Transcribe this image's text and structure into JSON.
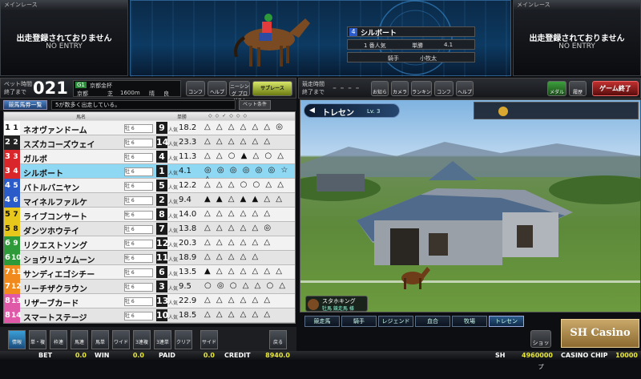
{
  "left_panel": {
    "header": "メインレース",
    "msg_jp": "出走登録されておりません",
    "msg_en": "NO ENTRY"
  },
  "right_panel": {
    "header": "メインレース",
    "msg_jp": "出走登録されておりません",
    "msg_en": "NO ENTRY"
  },
  "center_info": {
    "num": "4",
    "name": "シルボート",
    "pop_label": "1 番人気",
    "tansho_label": "単勝",
    "tansho": "4.1",
    "jockey_label": "騎手",
    "jockey": "小牧太"
  },
  "bet_timer": {
    "label1": "ベット時間",
    "label2": "終了まで",
    "value": "021"
  },
  "race": {
    "grade": "G1",
    "name": "京都金杯",
    "venue": "京都",
    "surface": "芝",
    "distance": "1600m",
    "going": "晴",
    "going2": "良"
  },
  "top_buttons": [
    "コンフィグ",
    "ヘルプ",
    "ニーシング プログラム",
    "サブレース"
  ],
  "notice": "5が数多く出走している。",
  "list_tab": "競馬馬券一覧",
  "bet_rank": "ベット条件",
  "columns": {
    "name": "馬名",
    "odds": "単勝"
  },
  "horses": [
    {
      "b": "1",
      "n": "1",
      "name": "ネオヴァンドーム",
      "tag": "牡 6",
      "pop": "9",
      "odds": "18.2",
      "m": "△ △ △ △ △ △ ◎"
    },
    {
      "b": "2",
      "n": "2",
      "name": "スズカコーズウェイ",
      "tag": "牡 6",
      "pop": "14",
      "odds": "23.3",
      "m": "△ △ △ △ △ △"
    },
    {
      "b": "3",
      "n": "3",
      "name": "ガルボ",
      "tag": "牡 6",
      "pop": "4",
      "odds": "11.3",
      "m": "△ △ ○ ▲ △ ○ △"
    },
    {
      "b": "3",
      "n": "4",
      "name": "シルボート",
      "tag": "牡 6",
      "pop": "1",
      "odds": "4.1",
      "m": "◎ ◎ ◎ ◎ ◎ ◎ ☆ △"
    },
    {
      "b": "4",
      "n": "5",
      "name": "バトルバニヤン",
      "tag": "牡 6",
      "pop": "5",
      "odds": "12.2",
      "m": "△ △ △ ○ ○ △ △"
    },
    {
      "b": "4",
      "n": "6",
      "name": "マイネルファルケ",
      "tag": "牡 6",
      "pop": "2",
      "odds": "9.4",
      "m": "▲ ▲ △ ▲ ▲ △ △"
    },
    {
      "b": "5",
      "n": "7",
      "name": "ライブコンサート",
      "tag": "牝 6",
      "pop": "8",
      "odds": "14.0",
      "m": "△ △ △ △ △ △"
    },
    {
      "b": "5",
      "n": "8",
      "name": "ダンツホウテイ",
      "tag": "牡 6",
      "pop": "7",
      "odds": "13.8",
      "m": "△ △ △ △ △ ◎"
    },
    {
      "b": "6",
      "n": "9",
      "name": "リクエストソング",
      "tag": "牡 6",
      "pop": "12",
      "odds": "20.3",
      "m": "△ △ △ △ △ △"
    },
    {
      "b": "6",
      "n": "10",
      "name": "ショウリュウムーン",
      "tag": "牝 6",
      "pop": "11",
      "odds": "18.9",
      "m": "△ △ △ △ △"
    },
    {
      "b": "7",
      "n": "11",
      "name": "サンディエゴシチー",
      "tag": "牡 6",
      "pop": "6",
      "odds": "13.5",
      "m": "▲ △ △ △ △ △ △"
    },
    {
      "b": "7",
      "n": "12",
      "name": "リーチザクラウン",
      "tag": "牡 6",
      "pop": "3",
      "odds": "9.5",
      "m": "○ ◎ ○ △ △ ○ △"
    },
    {
      "b": "8",
      "n": "13",
      "name": "リザーブカード",
      "tag": "牡 6",
      "pop": "13",
      "odds": "22.9",
      "m": "△ △ △ △ △ △"
    },
    {
      "b": "8",
      "n": "14",
      "name": "スマートステージ",
      "tag": "牡 6",
      "pop": "10",
      "odds": "18.5",
      "m": "△ △ △ △ △ △"
    }
  ],
  "bet_buttons": [
    "情報",
    "単・複",
    "枠連",
    "馬連",
    "馬単",
    "ワイド",
    "3連複",
    "3連単",
    "クリア",
    "サイド",
    "戻る"
  ],
  "status": {
    "bet_label": "BET",
    "bet": "0.0",
    "win_label": "WIN",
    "win": "0.0",
    "paid_label": "PAID",
    "paid": "0.0",
    "credit_label": "CREDIT",
    "credit": "8940.0",
    "sh_label": "SH",
    "sh": "4960000",
    "chip_label": "CASINO CHIP",
    "chip": "10000"
  },
  "right_header": {
    "label1": "競走時間",
    "label2": "終了まで",
    "buttons": [
      "お知らせ",
      "カメラ",
      "ランキング",
      "コンフィグ",
      "ヘルプ"
    ],
    "mode": "メダル",
    "history": "履歴",
    "end_game": "ゲーム終了"
  },
  "stable": {
    "name": "トレセン",
    "level": "Lv. 3",
    "horse_name": "スタホキング",
    "horse_sub": "牡馬 競走馬 様",
    "tabs": [
      "競走馬",
      "騎手",
      "レジェンド",
      "血合",
      "牧場",
      "トレセン"
    ],
    "shop": "ショップ",
    "logo": "SH Casino"
  },
  "colors": {
    "accent": "#36b7f0",
    "bracket": [
      "#ffffff",
      "#222222",
      "#d8262a",
      "#2b5ac9",
      "#e8c71d",
      "#2f9a3a",
      "#f08a1c",
      "#e058a8"
    ]
  }
}
